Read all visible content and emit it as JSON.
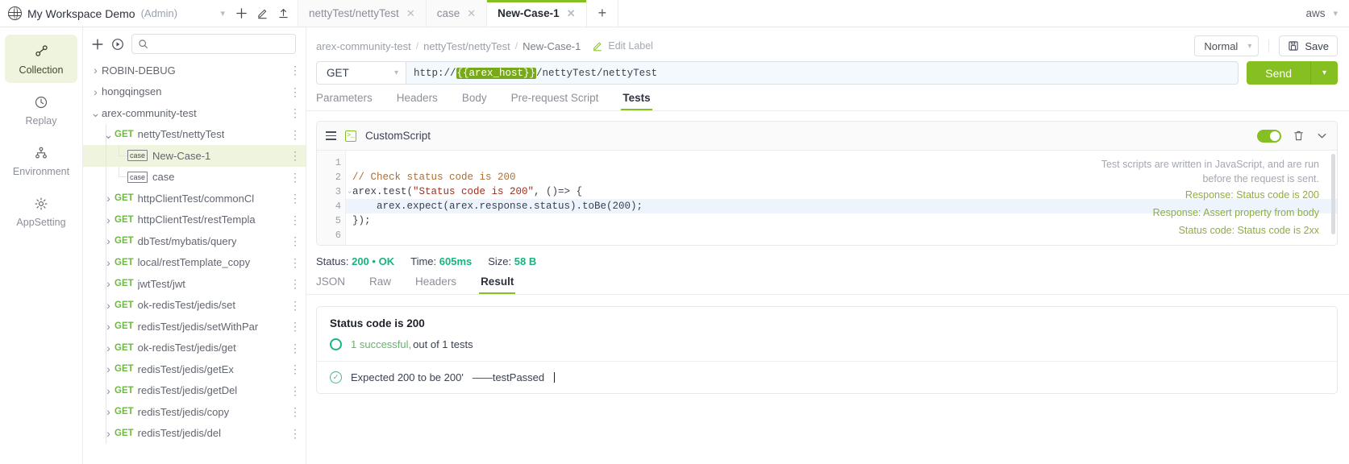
{
  "topbar": {
    "workspace_icon": "globe-icon",
    "workspace_name": "My Workspace Demo",
    "workspace_role": "(Admin)",
    "add_label": "+",
    "edit_icon": "pencil-icon",
    "upload_icon": "upload-icon",
    "account_label": "aws",
    "tabs": [
      {
        "label": "nettyTest/nettyTest",
        "active": false
      },
      {
        "label": "case",
        "active": false
      },
      {
        "label": "New-Case-1",
        "active": true
      }
    ],
    "new_tab_label": "+"
  },
  "rail": {
    "items": [
      {
        "label": "Collection",
        "icon": "collection-icon",
        "active": true
      },
      {
        "label": "Replay",
        "icon": "clock-icon",
        "active": false
      },
      {
        "label": "Environment",
        "icon": "sitemap-icon",
        "active": false
      },
      {
        "label": "AppSetting",
        "icon": "gear-icon",
        "active": false
      }
    ]
  },
  "tree": {
    "add_label": "+",
    "run_icon": "play-circle-icon",
    "search_placeholder": "",
    "search_value": "",
    "items": [
      {
        "depth": 0,
        "arrow": "right",
        "label": "ROBIN-DEBUG",
        "method": "",
        "badge": "",
        "selected": false
      },
      {
        "depth": 0,
        "arrow": "right",
        "label": "hongqingsen",
        "method": "",
        "badge": "",
        "selected": false
      },
      {
        "depth": 0,
        "arrow": "down",
        "label": "arex-community-test",
        "method": "",
        "badge": "",
        "selected": false
      },
      {
        "depth": 1,
        "arrow": "down",
        "label": "nettyTest/nettyTest",
        "method": "GET",
        "badge": "",
        "selected": false
      },
      {
        "depth": 2,
        "arrow": "",
        "label": "New-Case-1",
        "method": "",
        "badge": "case",
        "selected": true
      },
      {
        "depth": 2,
        "arrow": "",
        "label": "case",
        "method": "",
        "badge": "case",
        "selected": false
      },
      {
        "depth": 1,
        "arrow": "right",
        "label": "httpClientTest/commonCl",
        "method": "GET",
        "badge": "",
        "selected": false
      },
      {
        "depth": 1,
        "arrow": "right",
        "label": "httpClientTest/restTempla",
        "method": "GET",
        "badge": "",
        "selected": false
      },
      {
        "depth": 1,
        "arrow": "right",
        "label": "dbTest/mybatis/query",
        "method": "GET",
        "badge": "",
        "selected": false
      },
      {
        "depth": 1,
        "arrow": "right",
        "label": "local/restTemplate_copy",
        "method": "GET",
        "badge": "",
        "selected": false
      },
      {
        "depth": 1,
        "arrow": "right",
        "label": "jwtTest/jwt",
        "method": "GET",
        "badge": "",
        "selected": false
      },
      {
        "depth": 1,
        "arrow": "right",
        "label": "ok-redisTest/jedis/set",
        "method": "GET",
        "badge": "",
        "selected": false
      },
      {
        "depth": 1,
        "arrow": "right",
        "label": "redisTest/jedis/setWithPar",
        "method": "GET",
        "badge": "",
        "selected": false
      },
      {
        "depth": 1,
        "arrow": "right",
        "label": "ok-redisTest/jedis/get",
        "method": "GET",
        "badge": "",
        "selected": false
      },
      {
        "depth": 1,
        "arrow": "right",
        "label": "redisTest/jedis/getEx",
        "method": "GET",
        "badge": "",
        "selected": false
      },
      {
        "depth": 1,
        "arrow": "right",
        "label": "redisTest/jedis/getDel",
        "method": "GET",
        "badge": "",
        "selected": false
      },
      {
        "depth": 1,
        "arrow": "right",
        "label": "redisTest/jedis/copy",
        "method": "GET",
        "badge": "",
        "selected": false
      },
      {
        "depth": 1,
        "arrow": "right",
        "label": "redisTest/jedis/del",
        "method": "GET",
        "badge": "",
        "selected": false
      }
    ]
  },
  "request": {
    "breadcrumb": [
      "arex-community-test",
      "nettyTest/nettyTest",
      "New-Case-1"
    ],
    "breadcrumb_separator": "/",
    "edit_label": "Edit Label",
    "edit_label_icon": "pencil-icon",
    "mode_label": "Normal",
    "save_label": "Save",
    "save_icon": "floppy-icon",
    "method": "GET",
    "url_prefix": "http://",
    "url_variable": "{{arex_host}}",
    "url_suffix": "/nettyTest/nettyTest",
    "send_label": "Send",
    "tabs": [
      {
        "label": "Parameters",
        "active": false
      },
      {
        "label": "Headers",
        "active": false
      },
      {
        "label": "Body",
        "active": false
      },
      {
        "label": "Pre-request Script",
        "active": false
      },
      {
        "label": "Tests",
        "active": true
      }
    ]
  },
  "script": {
    "menu_icon": "hamburger-icon",
    "type_icon": "terminal-icon",
    "title": "CustomScript",
    "enabled": true,
    "delete_icon": "trash-icon",
    "collapse_icon": "chevron-down-icon",
    "line_numbers": [
      "1",
      "2",
      "3",
      "4",
      "5",
      "6"
    ],
    "lines": [
      {
        "text": "",
        "kind": "plain",
        "highlight": false
      },
      {
        "text": "// Check status code is 200",
        "kind": "comment",
        "highlight": false
      },
      {
        "text": "arex.test(\"Status code is 200\", ()=> {",
        "kind": "code-string",
        "highlight": false
      },
      {
        "text": "    arex.expect(arex.response.status).toBe(200);",
        "kind": "plain",
        "highlight": true
      },
      {
        "text": "});",
        "kind": "plain",
        "highlight": false
      },
      {
        "text": "",
        "kind": "plain",
        "highlight": false
      }
    ],
    "hint_paragraph": "Test scripts are written in JavaScript, and are run before the request is sent.",
    "hint_links": [
      "Response: Status code is 200",
      "Response: Assert property from body",
      "Status code: Status code is 2xx"
    ]
  },
  "response": {
    "status_label": "Status:",
    "status_code": "200",
    "status_sep": "•",
    "status_text": "OK",
    "time_label": "Time:",
    "time_value": "605ms",
    "size_label": "Size:",
    "size_value": "58 B",
    "tabs": [
      {
        "label": "JSON",
        "active": false
      },
      {
        "label": "Raw",
        "active": false
      },
      {
        "label": "Headers",
        "active": false
      },
      {
        "label": "Result",
        "active": true
      }
    ],
    "result": {
      "title": "Status code is 200",
      "summary_icon": "circle-icon",
      "summary_pass": "1 successful,",
      "summary_rest": "out of 1 tests",
      "assertion_icon": "check-circle-icon",
      "assertion_text": "Expected 200 to be 200'",
      "assertion_dash": "——",
      "assertion_status": "testPassed"
    }
  },
  "colors": {
    "accent_green": "#85bf22",
    "success_teal": "#18b37e",
    "selection_bg": "#eef4dd",
    "method_green": "#6cbb3c"
  }
}
